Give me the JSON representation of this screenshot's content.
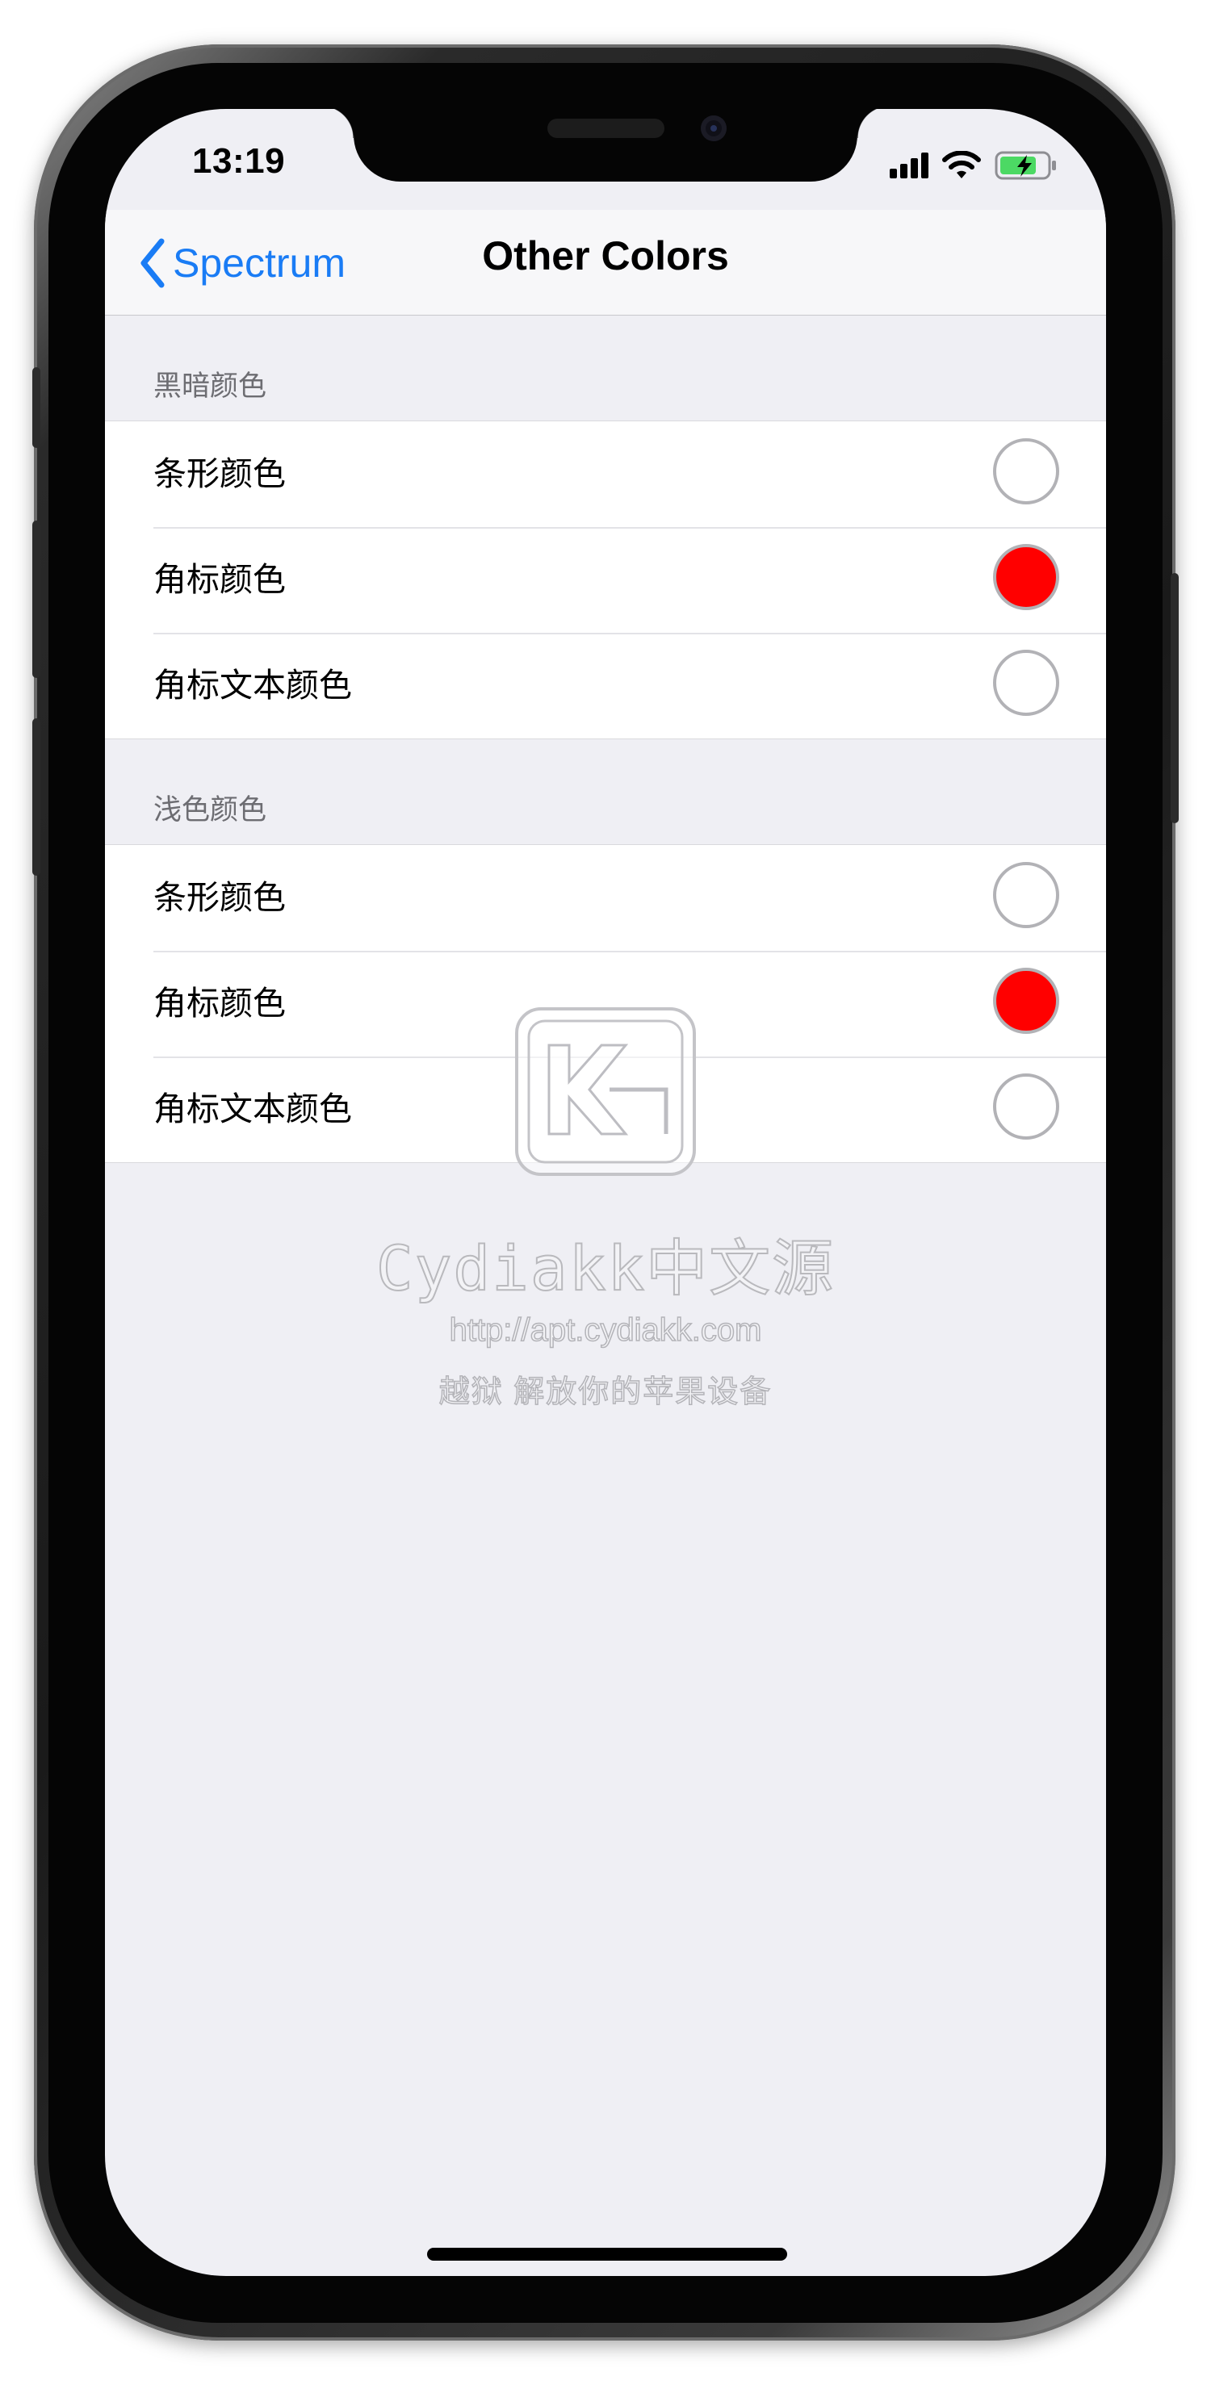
{
  "status_bar": {
    "time": "13:19"
  },
  "navbar": {
    "back_label": "Spectrum",
    "title": "Other Colors"
  },
  "sections": [
    {
      "header": "黑暗颜色",
      "rows": [
        {
          "label": "条形颜色",
          "color": "#ffffff"
        },
        {
          "label": "角标颜色",
          "color": "#ff0000"
        },
        {
          "label": "角标文本颜色",
          "color": "#ffffff"
        }
      ]
    },
    {
      "header": "浅色颜色",
      "rows": [
        {
          "label": "条形颜色",
          "color": "#ffffff"
        },
        {
          "label": "角标颜色",
          "color": "#ff0000"
        },
        {
          "label": "角标文本颜色",
          "color": "#ffffff"
        }
      ]
    }
  ],
  "watermark": {
    "name": "Cydiakk中文源",
    "url": "http://apt.cydiakk.com",
    "slogan": "越狱 解放你的苹果设备"
  },
  "colors": {
    "accent": "#1a7cf5",
    "background": "#efeff4",
    "swatch_border": "#b2b2b6"
  }
}
